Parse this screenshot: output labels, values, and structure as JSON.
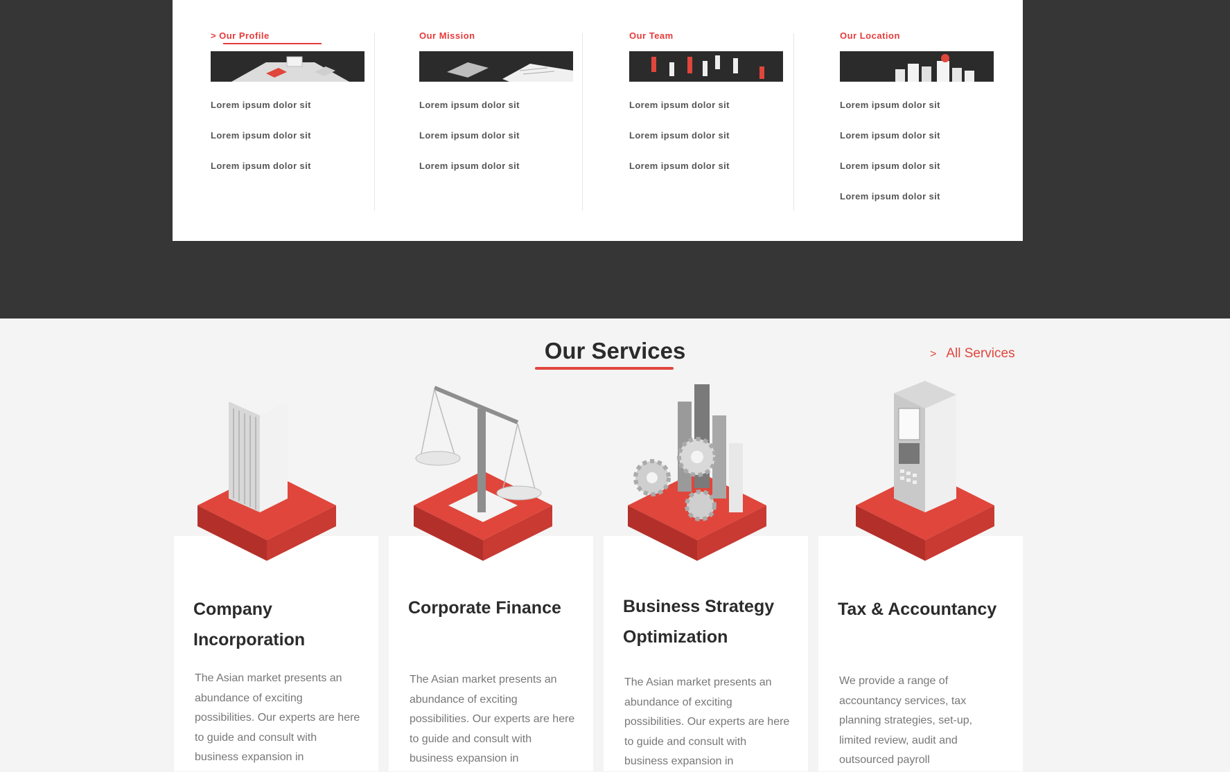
{
  "about": {
    "columns": [
      {
        "title": "Our Profile",
        "items": [
          "Lorem ipsum dolor sit",
          "Lorem ipsum dolor sit",
          "Lorem ipsum dolor sit"
        ]
      },
      {
        "title": "Our Mission",
        "items": [
          "Lorem ipsum dolor sit",
          "Lorem ipsum dolor sit",
          "Lorem ipsum dolor sit"
        ]
      },
      {
        "title": "Our Team",
        "items": [
          "Lorem ipsum dolor sit",
          "Lorem ipsum dolor sit",
          "Lorem ipsum dolor sit"
        ]
      },
      {
        "title": "Our Location",
        "items": [
          "Lorem ipsum dolor sit",
          "Lorem ipsum dolor sit",
          "Lorem ipsum dolor sit",
          "Lorem ipsum dolor sit"
        ]
      }
    ],
    "active_chevron": ">"
  },
  "services": {
    "heading": "Our Services",
    "all_link": "All Services",
    "all_link_chevron": ">",
    "cards": [
      {
        "title": "Company Incorporation",
        "icon": "office-building-icon",
        "description": "The Asian market presents an abundance of exciting possibilities. Our experts are here to guide and consult with business expansion in"
      },
      {
        "title": "Corporate Finance",
        "icon": "balance-scale-icon",
        "description": "The Asian market presents an abundance of exciting possibilities. Our experts are here to guide and consult with business expansion in"
      },
      {
        "title": "Business Strategy Optimization",
        "icon": "gears-chart-icon",
        "description": "The Asian market presents an abundance of exciting possibilities. Our experts are here to guide and consult with business expansion in"
      },
      {
        "title": "Tax & Accountancy",
        "icon": "cash-register-icon",
        "description": "We provide a range of accountancy services, tax planning strategies, set-up, limited review, audit and outsourced payroll"
      }
    ]
  },
  "colors": {
    "accent": "#e0463b",
    "dark_band": "#363636",
    "page_bg": "#f4f4f4",
    "card_bg": "#ffffff"
  }
}
